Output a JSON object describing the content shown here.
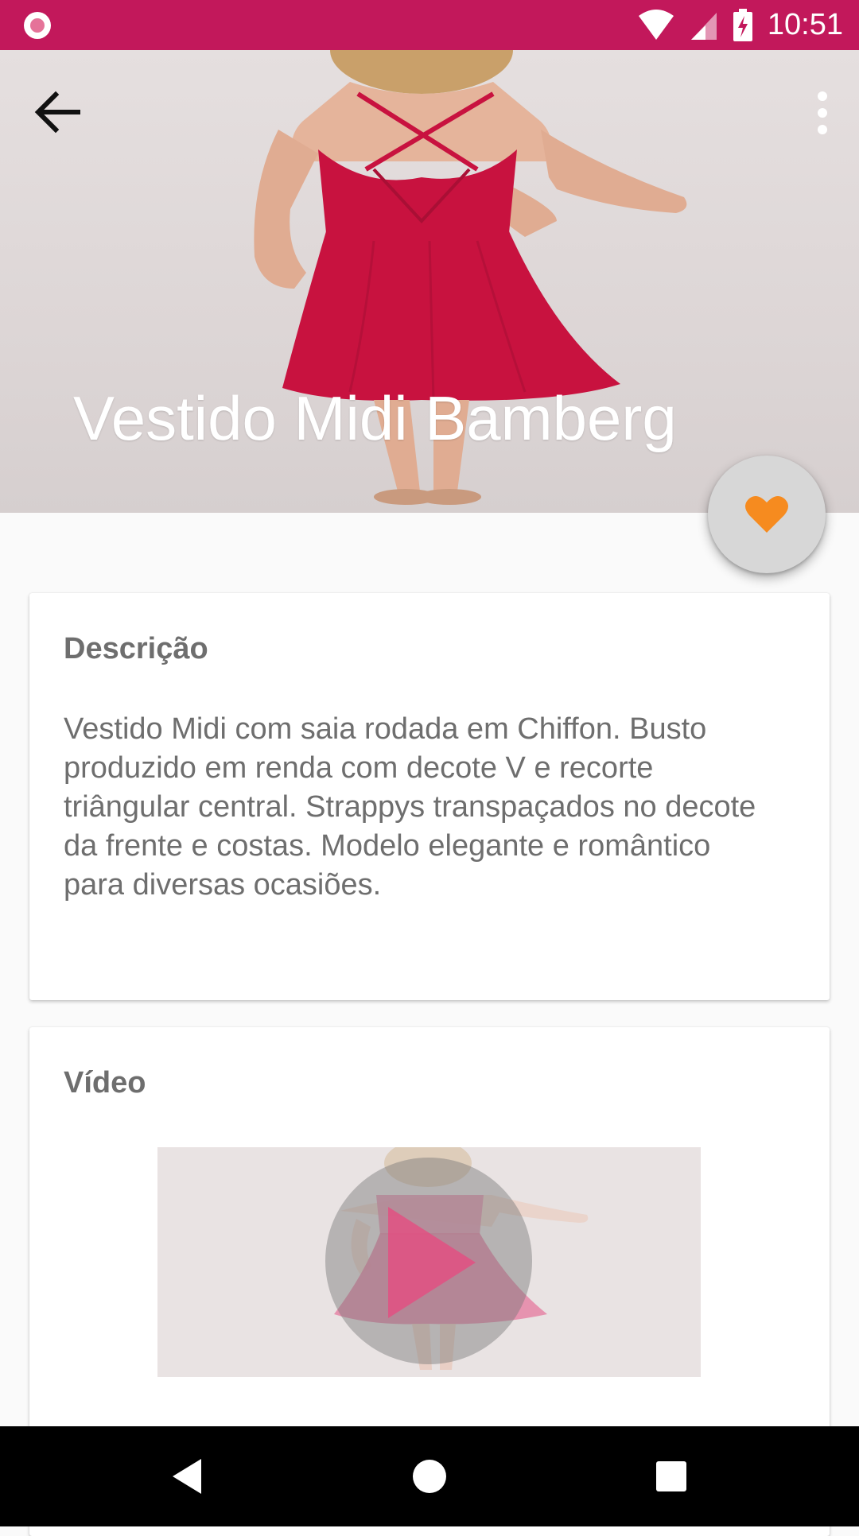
{
  "status_bar": {
    "time": "10:51",
    "icons": [
      "app-notification-icon",
      "wifi-icon",
      "signal-icon",
      "battery-charging-icon"
    ]
  },
  "toolbar": {
    "back_icon": "arrow-back-icon",
    "menu_icon": "more-vert-icon"
  },
  "product": {
    "title": "Vestido Midi Bamberg",
    "favorite_icon": "heart-icon",
    "favorite_color": "#f68b1f"
  },
  "description_card": {
    "heading": "Descrição",
    "lines": [
      "Vestido Midi com saia rodada em Chiffon. Busto",
      "produzido em renda com decote V e recorte",
      "triângular central. Strappys transpaçados no decote",
      "da frente e costas. Modelo elegante e romântico",
      "para diversas ocasiões."
    ]
  },
  "video_card": {
    "heading": "Vídeo",
    "play_icon": "play-icon",
    "play_color": "#e8487f"
  },
  "nav_bar": {
    "buttons": [
      "back-triangle-icon",
      "home-circle-icon",
      "recents-square-icon"
    ]
  },
  "colors": {
    "status_bar": "#c2185b",
    "dress": "#c8123f",
    "text_secondary": "#6e6e6e"
  }
}
